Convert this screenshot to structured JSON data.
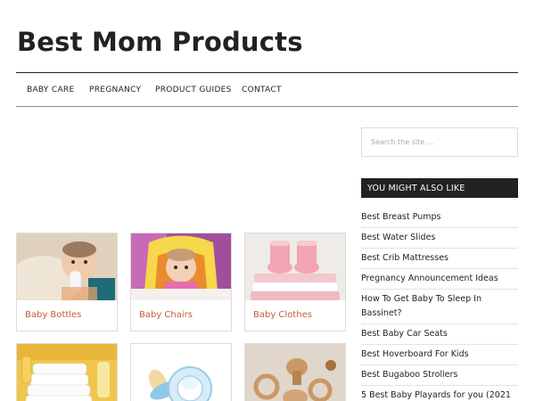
{
  "site": {
    "title": "Best Mom Products"
  },
  "nav": {
    "items": [
      {
        "label": "BABY CARE"
      },
      {
        "label": "PREGNANCY"
      },
      {
        "label": "PRODUCT GUIDES"
      },
      {
        "label": "CONTACT"
      }
    ]
  },
  "categories": [
    {
      "label": "Baby Bottles",
      "icon": "baby-bottle-photo"
    },
    {
      "label": "Baby Chairs",
      "icon": "baby-chair-photo"
    },
    {
      "label": "Baby Clothes",
      "icon": "baby-clothes-photo"
    },
    {
      "label": "",
      "icon": "diapers-photo"
    },
    {
      "label": "",
      "icon": "pacifier-photo"
    },
    {
      "label": "",
      "icon": "wooden-toys-photo"
    }
  ],
  "sidebar": {
    "search_placeholder": "Search the site ...",
    "widget_title": "YOU MIGHT ALSO LIKE",
    "links": [
      {
        "label": "Best Breast Pumps"
      },
      {
        "label": "Best Water Slides"
      },
      {
        "label": "Best Crib Mattresses"
      },
      {
        "label": "Pregnancy Announcement Ideas"
      },
      {
        "label": "How To Get Baby To Sleep In Bassinet?"
      },
      {
        "label": "Best Baby Car Seats"
      },
      {
        "label": "Best Hoverboard For Kids"
      },
      {
        "label": "Best Bugaboo Strollers"
      },
      {
        "label": "5 Best Baby Playards for you (2021"
      }
    ]
  },
  "colors": {
    "accent": "#c0603a",
    "dark": "#222222",
    "border": "#dcdcdc"
  }
}
